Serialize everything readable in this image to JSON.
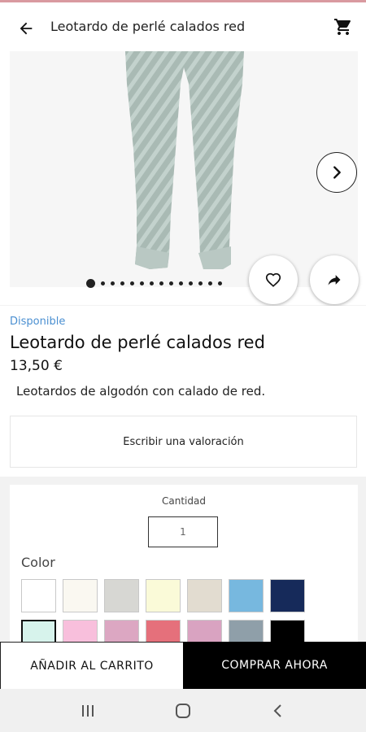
{
  "appbar": {
    "title": "Leotardo de perlé calados red",
    "back_icon": "arrow-left-icon",
    "cart_icon": "shopping-cart-icon"
  },
  "gallery": {
    "image": "grey-green-openwork-tights-photo",
    "dot_count": 14,
    "active_dot": 0,
    "next_icon": "chevron-right-icon",
    "favorite_icon": "heart-outline-icon",
    "share_icon": "share-arrow-icon"
  },
  "product": {
    "availability": "Disponible",
    "name": "Leotardo de perlé calados red",
    "price": "13,50 €",
    "description": "Leotardos de algodón con calado de red."
  },
  "review": {
    "label": "Escribir una valoración"
  },
  "options": {
    "quantity_label": "Cantidad",
    "quantity_value": "1",
    "color_label": "Color",
    "colors": [
      "#ffffff",
      "#faf8f1",
      "#d7d7d3",
      "#fafad8",
      "#e2dcd0",
      "#77b8df",
      "#162a5a",
      "#d7f3ec",
      "#f8bfdc",
      "#dca7c2",
      "#e5707b",
      "#d9a3c1",
      "#8f9fa9",
      "#000000"
    ]
  },
  "actions": {
    "add_to_cart": "AÑADIR AL CARRITO",
    "buy_now": "COMPRAR AHORA"
  },
  "system_nav": {
    "recents_icon": "recents-icon",
    "home_icon": "home-icon",
    "back_icon": "system-back-icon"
  }
}
